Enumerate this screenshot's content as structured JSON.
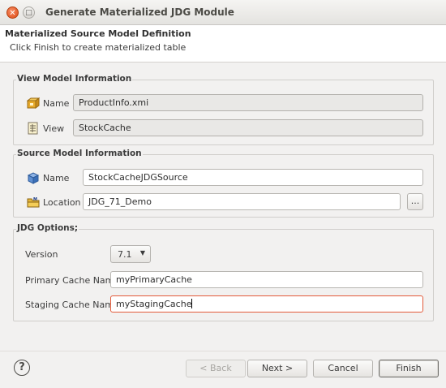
{
  "window": {
    "title": "Generate Materialized JDG Module"
  },
  "header": {
    "title": "Materialized Source Model Definition",
    "message": "Click Finish to create materialized table"
  },
  "view_model": {
    "group_title": "View Model Information",
    "name_label": "Name",
    "name_value": "ProductInfo.xmi",
    "view_label": "View",
    "view_value": "StockCache"
  },
  "source_model": {
    "group_title": "Source Model Information",
    "name_label": "Name",
    "name_value": "StockCacheJDGSource",
    "location_label": "Location",
    "location_value": "JDG_71_Demo",
    "browse_label": "..."
  },
  "jdg_options": {
    "group_title": "JDG Options;",
    "version_label": "Version",
    "version_value": "7.1",
    "primary_label": "Primary Cache Name",
    "primary_value": "myPrimaryCache",
    "staging_label": "Staging Cache Name",
    "staging_value": "myStagingCache"
  },
  "buttons": {
    "help": "?",
    "back": "< Back",
    "next": "Next >",
    "cancel": "Cancel",
    "finish": "Finish"
  },
  "colors": {
    "error_border": "#e35a3a",
    "close_button": "#df4b16"
  }
}
